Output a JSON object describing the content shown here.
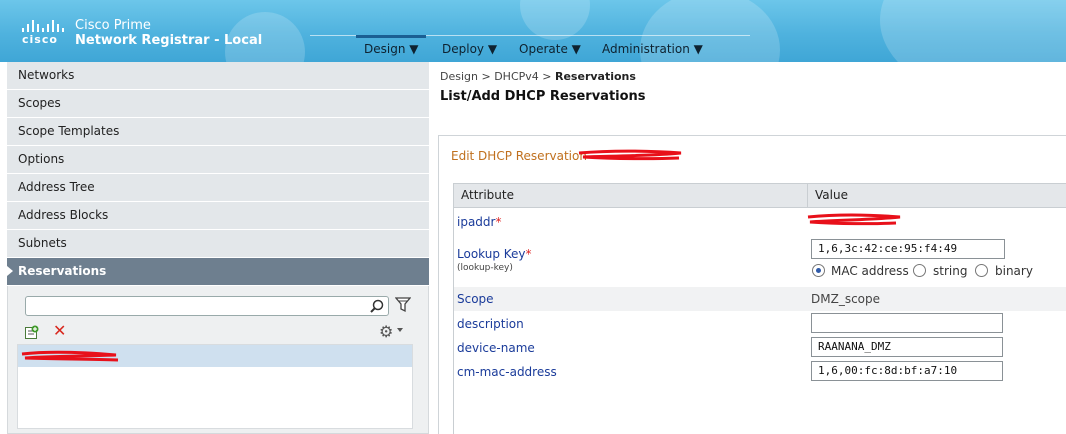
{
  "app": {
    "brand": "cisco",
    "title_line1": "Cisco Prime",
    "title_line2": "Network Registrar - Local"
  },
  "nav": [
    {
      "label": "Design ▼",
      "active": true
    },
    {
      "label": "Deploy ▼",
      "active": false
    },
    {
      "label": "Operate ▼",
      "active": false
    },
    {
      "label": "Administration ▼",
      "active": false
    }
  ],
  "sidebar": {
    "items": [
      "Networks",
      "Scopes",
      "Scope Templates",
      "Options",
      "Address Tree",
      "Address Blocks",
      "Subnets",
      "Reservations"
    ],
    "active_index": 7,
    "search_placeholder": ""
  },
  "breadcrumb": {
    "part1": "Design",
    "sep1": " > ",
    "part2": "DHCPv4",
    "sep2": " > ",
    "current": "Reservations"
  },
  "page_title": "List/Add DHCP Reservations",
  "card": {
    "title": "Edit DHCP Reservation"
  },
  "table": {
    "col_attribute": "Attribute",
    "col_value": "Value",
    "ipaddr_label": "ipaddr",
    "required_mark": "*",
    "lookup_key_label": "Lookup Key",
    "lookup_key_sub": "(lookup-key)",
    "lookup_key_value": "1,6,3c:42:ce:95:f4:49",
    "radio_mac": "MAC address",
    "radio_string": "string",
    "radio_binary": "binary",
    "scope_label": "Scope",
    "scope_value": "DMZ_scope",
    "description_label": "description",
    "description_value": "",
    "device_name_label": "device-name",
    "device_name_value": "RAANANA_DMZ",
    "cm_mac_label": "cm-mac-address",
    "cm_mac_value": "1,6,00:fc:8d:bf:a7:10"
  },
  "colors": {
    "header": "#4fb2de",
    "active_tab_border": "#1a5f93",
    "sidebar_active": "#6e7f8f",
    "link": "#1a3b9a",
    "card_title": "#c0701e",
    "redaction": "#e8101a"
  }
}
